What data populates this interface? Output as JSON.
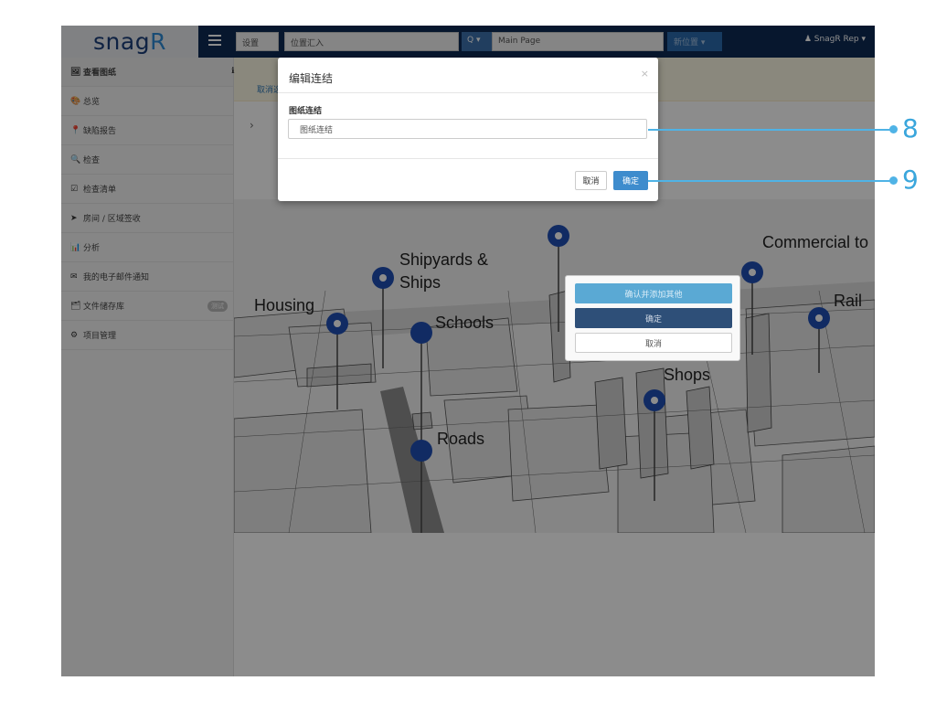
{
  "topbar": {
    "logo_text": "snag",
    "logo_r": "R",
    "settings_label": "设置",
    "location_label": "位置汇入",
    "search_dropdown": "Q ▾",
    "search_value": "Main Page",
    "new_location": "新位置 ▾",
    "user": "SnagR Rep ▾"
  },
  "sidebar": {
    "items": [
      {
        "icon": "🖼",
        "label": "查看图纸"
      },
      {
        "icon": "🎨",
        "label": "总览"
      },
      {
        "icon": "📍",
        "label": "缺陷报告"
      },
      {
        "icon": "🔍",
        "label": "检查"
      },
      {
        "icon": "☑",
        "label": "检查清单"
      },
      {
        "icon": "➤",
        "label": "房间 / 区域签收"
      },
      {
        "icon": "📊",
        "label": "分析"
      },
      {
        "icon": "✉",
        "label": "我的电子邮件通知"
      },
      {
        "icon": "🗂",
        "label": "文件储存库",
        "badge": "测试"
      },
      {
        "icon": "⚙",
        "label": "项目管理"
      }
    ]
  },
  "main": {
    "info_icon": "ℹ",
    "info_text": "取消选",
    "crumb": "›"
  },
  "map": {
    "labels": [
      "Housing",
      "Shipyards &",
      "Ships",
      "Schools",
      "Roads",
      "Commercial to",
      "Rail",
      "Shops"
    ]
  },
  "action_menu": {
    "confirm_add": "确认并添加其他",
    "confirm": "确定",
    "cancel": "取消"
  },
  "modal": {
    "title": "编辑连结",
    "close": "×",
    "field_label": "图纸连结",
    "field_value": "图纸连结",
    "cancel": "取消",
    "ok": "确定"
  },
  "callouts": [
    "8",
    "9"
  ],
  "colors": {
    "topbar": "#0d2a55",
    "accent": "#3e8ccd",
    "callout": "#4fb3e6",
    "pin": "#1f4fb5"
  }
}
